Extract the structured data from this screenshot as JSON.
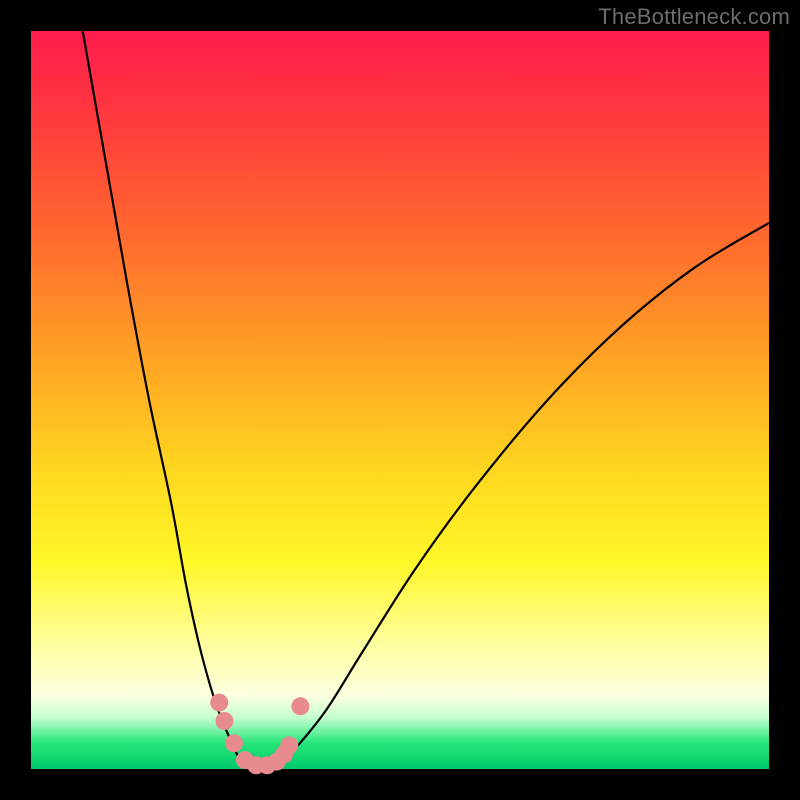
{
  "watermark": "TheBottleneck.com",
  "colors": {
    "frame": "#000000",
    "curve": "#000000",
    "markers": "#e78b8f",
    "gradient_stops": [
      "#ff1c4d",
      "#ff6a2e",
      "#ffd81f",
      "#ffffa8",
      "#00c96b"
    ]
  },
  "chart_data": {
    "type": "line",
    "title": "",
    "xlabel": "",
    "ylabel": "",
    "xlim": [
      0,
      100
    ],
    "ylim": [
      0,
      100
    ],
    "grid": false,
    "legend": false,
    "note": "Background vertical gradient maps y≈100 (top) → red, y≈0 (bottom) → green. No numeric axis labels visible; values estimated from pixel position.",
    "series": [
      {
        "name": "bottleneck-curve",
        "x": [
          7,
          10,
          13,
          16,
          19,
          21,
          23,
          25,
          27,
          28.5,
          30,
          32,
          34,
          36,
          40,
          45,
          52,
          60,
          70,
          80,
          90,
          100
        ],
        "y": [
          100,
          83,
          66,
          50,
          36,
          25,
          16,
          9,
          4,
          1,
          0,
          0,
          1,
          3,
          8,
          16,
          27,
          38,
          50,
          60,
          68,
          74
        ]
      }
    ],
    "markers": {
      "name": "highlighted-points",
      "points": [
        {
          "x": 25.5,
          "y": 9
        },
        {
          "x": 26.2,
          "y": 6.5
        },
        {
          "x": 27.5,
          "y": 3.5
        },
        {
          "x": 29.0,
          "y": 1.2
        },
        {
          "x": 30.5,
          "y": 0.5
        },
        {
          "x": 32.0,
          "y": 0.5
        },
        {
          "x": 33.3,
          "y": 1.0
        },
        {
          "x": 34.3,
          "y": 2.0
        },
        {
          "x": 35.0,
          "y": 3.2
        },
        {
          "x": 36.5,
          "y": 8.5
        }
      ]
    }
  }
}
